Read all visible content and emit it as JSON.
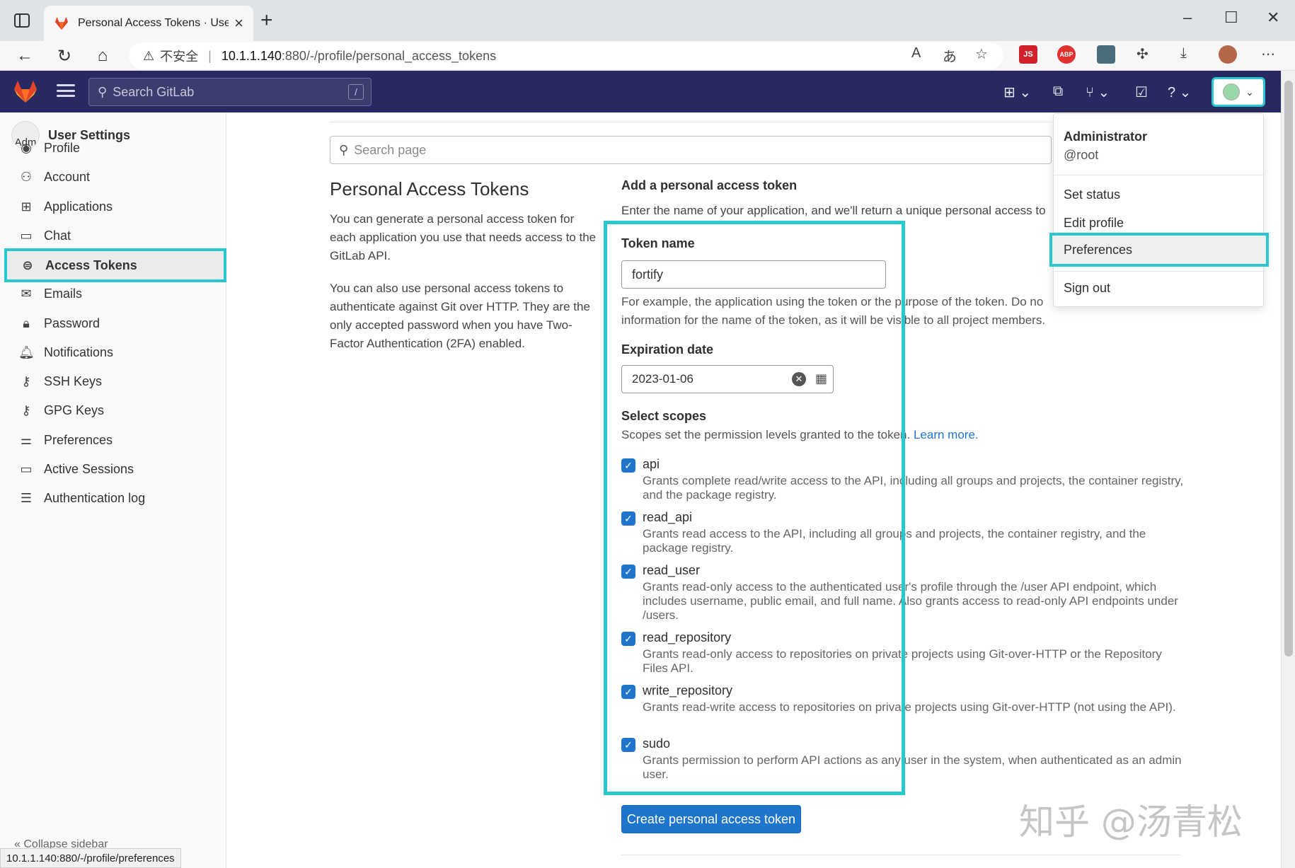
{
  "browser": {
    "tab_title": "Personal Access Tokens · User Se",
    "url_insecure_label": "不安全",
    "url_host": "10.1.1.140",
    "url_path": ":880/-/profile/personal_access_tokens",
    "status_url": "10.1.1.140:880/-/profile/preferences",
    "ext_js_label": "JS",
    "ext_abp_label": "ABP"
  },
  "gitlab_nav": {
    "search_placeholder": "Search GitLab",
    "search_shortcut": "/"
  },
  "sidebar": {
    "title": "User Settings",
    "avatar_text": "Adm",
    "items": [
      {
        "label": "Profile",
        "icon": "profile-icon"
      },
      {
        "label": "Account",
        "icon": "account-icon"
      },
      {
        "label": "Applications",
        "icon": "applications-icon"
      },
      {
        "label": "Chat",
        "icon": "chat-icon"
      },
      {
        "label": "Access Tokens",
        "icon": "token-icon"
      },
      {
        "label": "Emails",
        "icon": "mail-icon"
      },
      {
        "label": "Password",
        "icon": "lock-icon"
      },
      {
        "label": "Notifications",
        "icon": "bell-icon"
      },
      {
        "label": "SSH Keys",
        "icon": "key-icon"
      },
      {
        "label": "GPG Keys",
        "icon": "key-icon"
      },
      {
        "label": "Preferences",
        "icon": "preferences-icon"
      },
      {
        "label": "Active Sessions",
        "icon": "monitor-icon"
      },
      {
        "label": "Authentication log",
        "icon": "log-icon"
      }
    ],
    "collapse_label": "Collapse sidebar"
  },
  "main": {
    "search_placeholder": "Search page",
    "title": "Personal Access Tokens",
    "para1": "You can generate a personal access token for each application you use that needs access to the GitLab API.",
    "para2": "You can also use personal access tokens to authenticate against Git over HTTP. They are the only accepted password when you have Two-Factor Authentication (2FA) enabled.",
    "add_heading": "Add a personal access token",
    "add_desc": "Enter the name of your application, and we'll return a unique personal access to",
    "token_name_label": "Token name",
    "token_name_value": "fortify",
    "token_help_line1": "For example, the application using the token or the purpose of the token. Do no",
    "token_help_line2": "information for the name of the token, as it will be visible to all project members.",
    "expiration_label": "Expiration date",
    "expiration_value": "2023-01-06",
    "scopes_label": "Select scopes",
    "scopes_desc": "Scopes set the permission levels granted to the token.",
    "learn_more": "Learn more.",
    "scopes": [
      {
        "name": "api",
        "checked": true,
        "desc": "Grants complete read/write access to the API, including all groups and projects, the container registry, and the package registry."
      },
      {
        "name": "read_api",
        "checked": true,
        "desc": "Grants read access to the API, including all groups and projects, the container registry, and the package registry."
      },
      {
        "name": "read_user",
        "checked": true,
        "desc": "Grants read-only access to the authenticated user's profile through the /user API endpoint, which includes username, public email, and full name. Also grants access to read-only API endpoints under /users."
      },
      {
        "name": "read_repository",
        "checked": true,
        "desc": "Grants read-only access to repositories on private projects using Git-over-HTTP or the Repository Files API."
      },
      {
        "name": "write_repository",
        "checked": true,
        "desc": "Grants read-write access to repositories on private projects using Git-over-HTTP (not using the API)."
      },
      {
        "name": "sudo",
        "checked": true,
        "desc": "Grants permission to perform API actions as any user in the system, when authenticated as an admin user."
      }
    ],
    "create_button": "Create personal access token"
  },
  "user_menu": {
    "name": "Administrator",
    "username": "@root",
    "items": [
      "Set status",
      "Edit profile",
      "Preferences",
      "Sign out"
    ]
  },
  "watermark": "知乎 @汤青松",
  "colors": {
    "nav_bg": "#292961",
    "highlight": "#27c8d0",
    "primary": "#1f75cb"
  }
}
